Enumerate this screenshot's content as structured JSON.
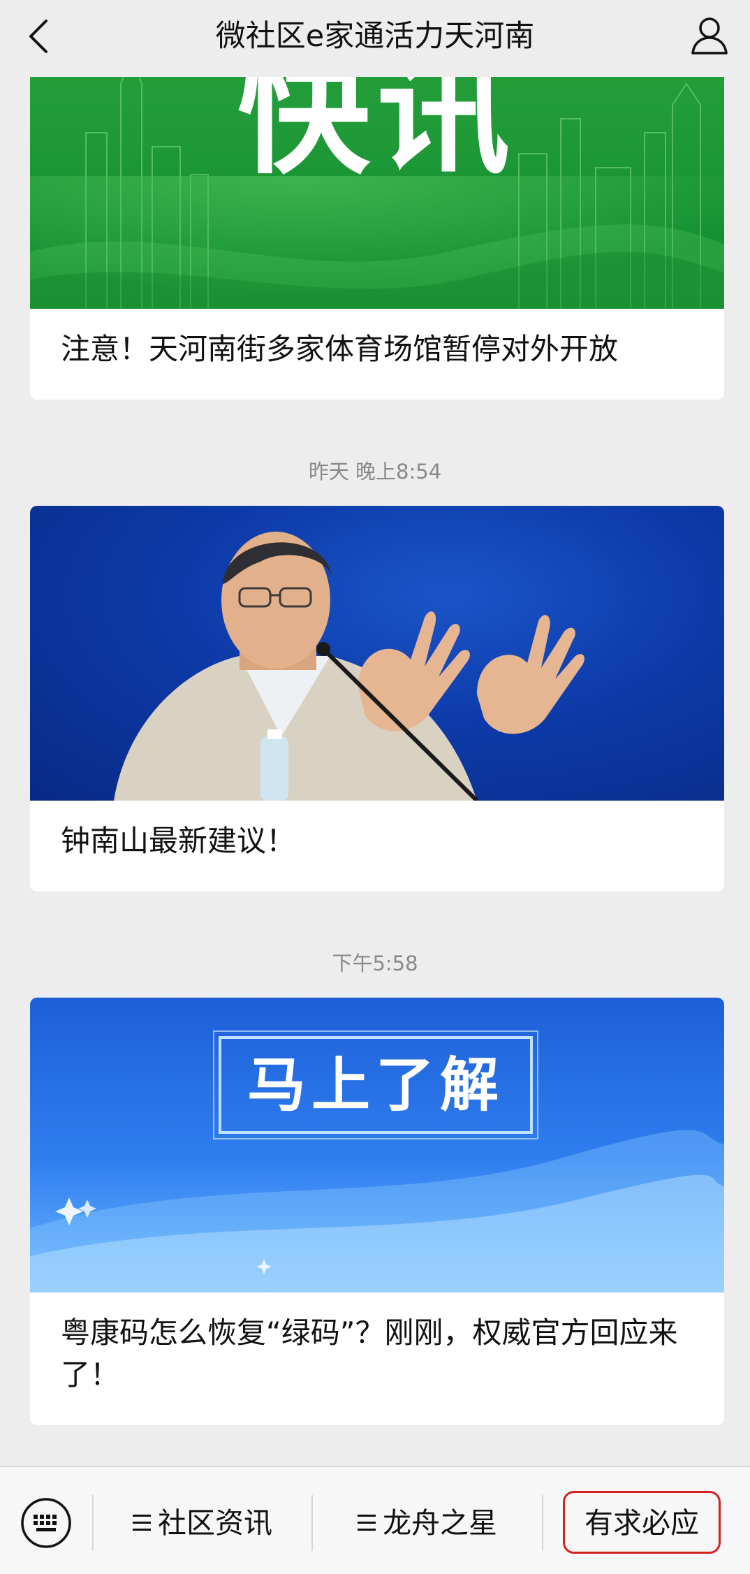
{
  "header": {
    "title": "微社区e家通活力天河南",
    "back_icon": "chevron-left-icon",
    "profile_icon": "user-icon"
  },
  "articles": [
    {
      "thumb_text": "快讯",
      "title": "注意！天河南街多家体育场馆暂停对外开放"
    },
    {
      "time": "昨天 晚上8:54",
      "title": "钟南山最新建议！"
    },
    {
      "time": "下午5:58",
      "thumb_text": "马上了解",
      "title": "粤康码怎么恢复“绿码”？刚刚，权威官方回应来了！"
    }
  ],
  "bottom_menu": {
    "keyboard_icon": "keyboard-icon",
    "items": [
      {
        "label": "社区资讯",
        "icon": "menu-icon"
      },
      {
        "label": "龙舟之星",
        "icon": "menu-icon"
      },
      {
        "label": "有求必应",
        "highlight_color": "#d32020"
      }
    ]
  }
}
